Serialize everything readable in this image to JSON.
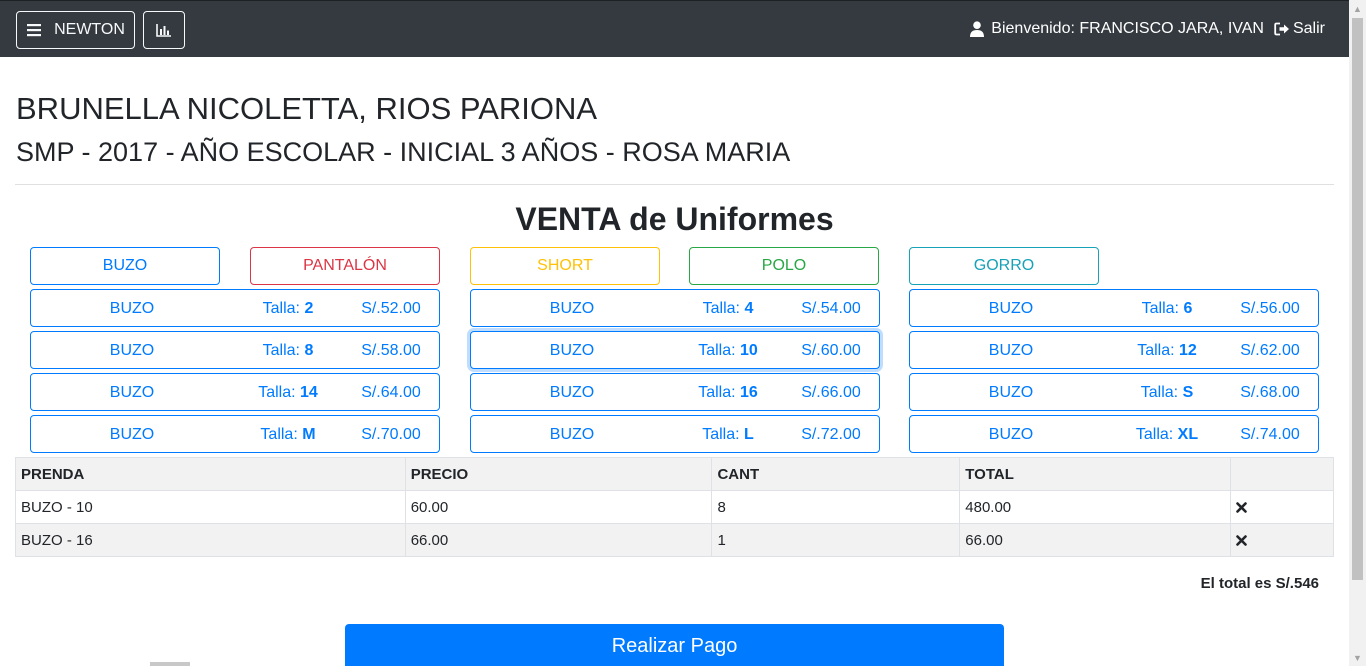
{
  "navbar": {
    "brand_label": "NEWTON",
    "brand_icon": "hamburger-menu-icon",
    "chart_icon": "bar-chart-icon",
    "welcome_text": "Bienvenido: FRANCISCO JARA, IVAN",
    "user_icon": "user-icon",
    "logout_label": "Salir",
    "logout_icon": "sign-out-icon",
    "background": "#343a40"
  },
  "student": {
    "name": "BRUNELLA NICOLETTA, RIOS PARIONA",
    "detail": "SMP - 2017 - AÑO ESCOLAR - INICIAL 3 AÑOS - ROSA MARIA"
  },
  "section_title": "VENTA de Uniformes",
  "categories": [
    {
      "label": "BUZO",
      "color": "#007bff"
    },
    {
      "label": "PANTALÓN",
      "color": "#dc3545"
    },
    {
      "label": "SHORT",
      "color": "#ffc107"
    },
    {
      "label": "POLO",
      "color": "#28a745"
    },
    {
      "label": "GORRO",
      "color": "#17a2b8"
    }
  ],
  "size_label": "Talla:",
  "items": [
    {
      "name": "BUZO",
      "size": "2",
      "price": "S/.52.00"
    },
    {
      "name": "BUZO",
      "size": "4",
      "price": "S/.54.00"
    },
    {
      "name": "BUZO",
      "size": "6",
      "price": "S/.56.00"
    },
    {
      "name": "BUZO",
      "size": "8",
      "price": "S/.58.00"
    },
    {
      "name": "BUZO",
      "size": "10",
      "price": "S/.60.00",
      "focused": true
    },
    {
      "name": "BUZO",
      "size": "12",
      "price": "S/.62.00"
    },
    {
      "name": "BUZO",
      "size": "14",
      "price": "S/.64.00"
    },
    {
      "name": "BUZO",
      "size": "16",
      "price": "S/.66.00"
    },
    {
      "name": "BUZO",
      "size": "S",
      "price": "S/.68.00"
    },
    {
      "name": "BUZO",
      "size": "M",
      "price": "S/.70.00"
    },
    {
      "name": "BUZO",
      "size": "L",
      "price": "S/.72.00"
    },
    {
      "name": "BUZO",
      "size": "XL",
      "price": "S/.74.00"
    }
  ],
  "cart": {
    "headers": [
      "PRENDA",
      "PRECIO",
      "CANT",
      "TOTAL",
      ""
    ],
    "rows": [
      {
        "item": "BUZO - 10",
        "price": "60.00",
        "qty": "8",
        "total": "480.00"
      },
      {
        "item": "BUZO - 16",
        "price": "66.00",
        "qty": "1",
        "total": "66.00"
      }
    ],
    "remove_icon": "close-icon",
    "total_text": "El total es S/.546"
  },
  "pay_button_label": "Realizar Pago",
  "accent_color": "#007bff"
}
